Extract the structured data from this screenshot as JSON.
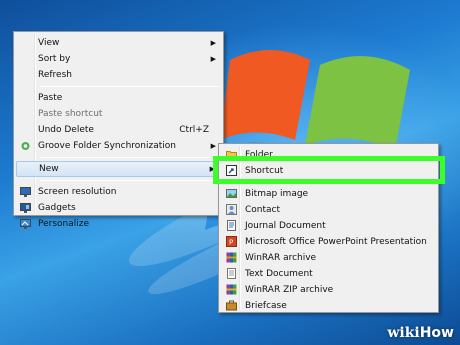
{
  "main_menu": {
    "items": [
      {
        "label": "View",
        "shortcut": "",
        "submenu": true,
        "disabled": false,
        "icon": ""
      },
      {
        "label": "Sort by",
        "shortcut": "",
        "submenu": true,
        "disabled": false,
        "icon": ""
      },
      {
        "label": "Refresh",
        "shortcut": "",
        "submenu": false,
        "disabled": false,
        "icon": ""
      },
      {
        "label": "Paste",
        "shortcut": "",
        "submenu": false,
        "disabled": false,
        "icon": ""
      },
      {
        "label": "Paste shortcut",
        "shortcut": "",
        "submenu": false,
        "disabled": true,
        "icon": ""
      },
      {
        "label": "Undo Delete",
        "shortcut": "Ctrl+Z",
        "submenu": false,
        "disabled": false,
        "icon": ""
      },
      {
        "label": "Groove Folder Synchronization",
        "shortcut": "",
        "submenu": true,
        "disabled": false,
        "icon": "groove-icon"
      },
      {
        "label": "New",
        "shortcut": "",
        "submenu": true,
        "disabled": false,
        "icon": ""
      },
      {
        "label": "Screen resolution",
        "shortcut": "",
        "submenu": false,
        "disabled": false,
        "icon": "monitor-icon"
      },
      {
        "label": "Gadgets",
        "shortcut": "",
        "submenu": false,
        "disabled": false,
        "icon": "gadgets-icon"
      },
      {
        "label": "Personalize",
        "shortcut": "",
        "submenu": false,
        "disabled": false,
        "icon": "personalize-icon"
      }
    ]
  },
  "new_submenu": {
    "items": [
      {
        "label": "Folder",
        "icon": "folder-icon"
      },
      {
        "label": "Shortcut",
        "icon": "shortcut-icon"
      },
      {
        "label": "Bitmap image",
        "icon": "bitmap-icon"
      },
      {
        "label": "Contact",
        "icon": "contact-icon"
      },
      {
        "label": "Journal Document",
        "icon": "journal-icon"
      },
      {
        "label": "Microsoft Office PowerPoint Presentation",
        "icon": "powerpoint-icon"
      },
      {
        "label": "WinRAR archive",
        "icon": "winrar-icon"
      },
      {
        "label": "Text Document",
        "icon": "text-document-icon"
      },
      {
        "label": "WinRAR ZIP archive",
        "icon": "winrar-zip-icon"
      },
      {
        "label": "Briefcase",
        "icon": "briefcase-icon"
      }
    ]
  },
  "highlight_color": "#3cff2a",
  "watermark": {
    "wiki": "wiki",
    "how": "How"
  }
}
